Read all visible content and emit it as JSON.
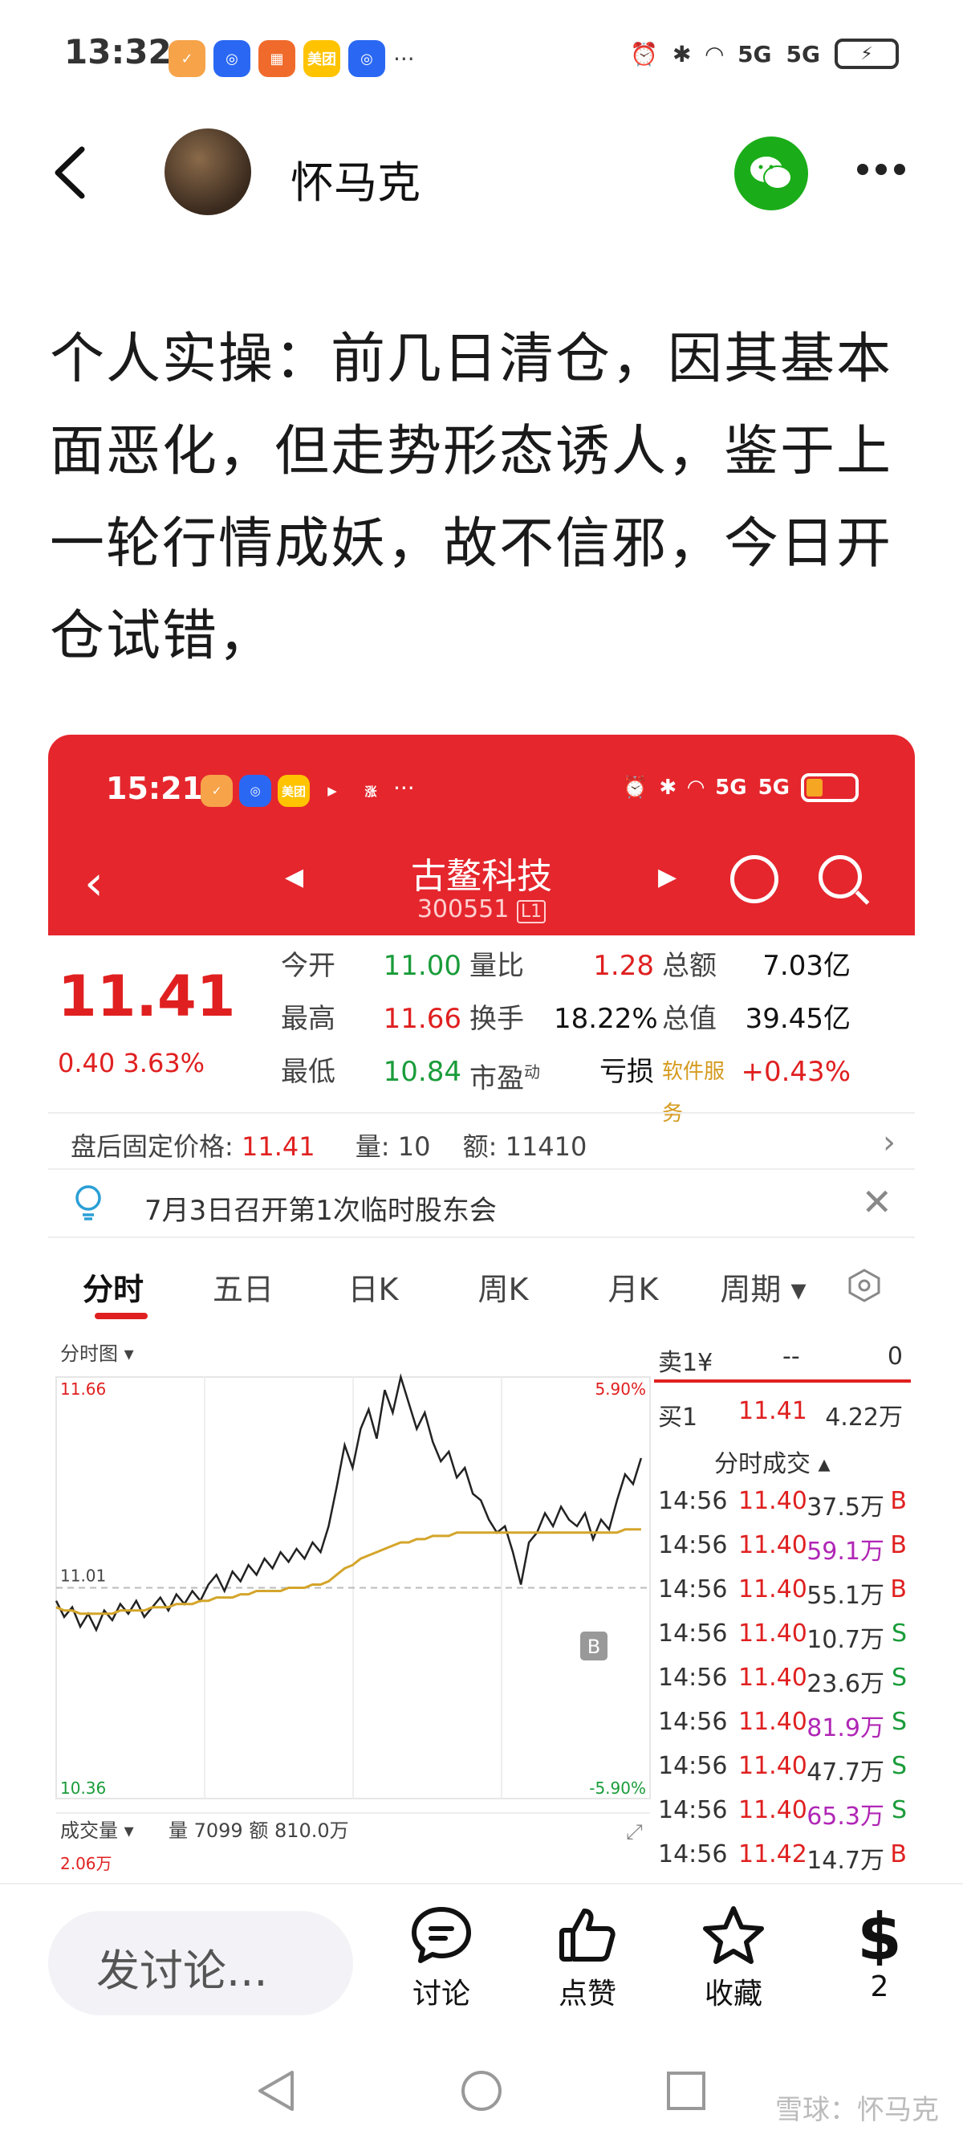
{
  "status_bar": {
    "time": "13:32",
    "apps": [
      {
        "label": "✓",
        "color": "#f6a34a"
      },
      {
        "label": "◎",
        "color": "#2a68f3"
      },
      {
        "label": "▦",
        "color": "#f06b2b"
      },
      {
        "label": "美团",
        "color": "#ffc300"
      },
      {
        "label": "◎",
        "color": "#2a68f3"
      }
    ],
    "more": "···",
    "sim1": "5G",
    "sim2": "5G"
  },
  "header": {
    "username": "怀马克"
  },
  "post": {
    "text": "个人实操：前几日清仓，因其基本面恶化，但走势形态诱人，鉴于上一轮行情成妖，故不信邪，今日开仓试错，"
  },
  "screenshot": {
    "status_time": "15:21",
    "inner_apps": [
      {
        "label": "✓",
        "color": "#f6a34a"
      },
      {
        "label": "◎",
        "color": "#2a68f3"
      },
      {
        "label": "美团",
        "color": "#ffc300"
      },
      {
        "label": "▶",
        "color": "#e5262d"
      },
      {
        "label": "涨",
        "color": "#e5262d"
      }
    ],
    "inner_more": "···",
    "stock_name": "古鳌科技",
    "stock_code": "300551",
    "stock_code_tag": "L1",
    "price": "11.41",
    "change": "0.40",
    "change_pct": "3.63%",
    "quote": {
      "open_label": "今开",
      "open": "11.00",
      "vol_ratio_label": "量比",
      "vol_ratio": "1.28",
      "amount_label": "总额",
      "amount": "7.03亿",
      "high_label": "最高",
      "high": "11.66",
      "turnover_label": "换手",
      "turnover": "18.22%",
      "mcap_label": "总值",
      "mcap": "39.45亿",
      "low_label": "最低",
      "low": "10.84",
      "pe_label": "市盈",
      "pe_sup": "动",
      "pe": "亏损",
      "sector": "软件服务",
      "sector_pct": "+0.43%"
    },
    "after_hours": {
      "label": "盘后固定价格:",
      "price": "11.41",
      "vol_label": "量:",
      "vol": "10",
      "amt_label": "额:",
      "amt": "11410"
    },
    "notice": "7月3日召开第1次临时股东会",
    "tabs": [
      "分时",
      "五日",
      "日K",
      "周K",
      "月K",
      "周期"
    ],
    "chart_title": "分时图",
    "vol_title": "成交量",
    "vol_text": "量 7099",
    "amt_text": "额 810.0万",
    "vol_max": "2.06万",
    "marker": "B",
    "orderbook": {
      "sell1_label": "卖1¥",
      "sell1_price": "--",
      "sell1_vol": "0",
      "buy1_label": "买1",
      "buy1_price": "11.41",
      "buy1_vol": "4.22万",
      "ticks_title": "分时成交",
      "ticks": [
        {
          "t": "14:56",
          "p": "11.40",
          "v": "37.5万",
          "s": "B",
          "hi": false
        },
        {
          "t": "14:56",
          "p": "11.40",
          "v": "59.1万",
          "s": "B",
          "hi": true
        },
        {
          "t": "14:56",
          "p": "11.40",
          "v": "55.1万",
          "s": "B",
          "hi": false
        },
        {
          "t": "14:56",
          "p": "11.40",
          "v": "10.7万",
          "s": "S",
          "hi": false
        },
        {
          "t": "14:56",
          "p": "11.40",
          "v": "23.6万",
          "s": "S",
          "hi": false
        },
        {
          "t": "14:56",
          "p": "11.40",
          "v": "81.9万",
          "s": "S",
          "hi": true
        },
        {
          "t": "14:56",
          "p": "11.40",
          "v": "47.7万",
          "s": "S",
          "hi": false
        },
        {
          "t": "14:56",
          "p": "11.40",
          "v": "65.3万",
          "s": "S",
          "hi": true
        },
        {
          "t": "14:56",
          "p": "11.42",
          "v": "14.7万",
          "s": "B",
          "hi": false
        }
      ]
    }
  },
  "chart_data": {
    "type": "line",
    "title": "分时图",
    "y_max_label": "11.66",
    "y_min_label": "10.36",
    "pct_max_label": "5.90%",
    "pct_min_label": "-5.90%",
    "prev_close_label": "11.01",
    "ylim": [
      10.36,
      11.66
    ],
    "prev_close": 11.01,
    "series": [
      {
        "values": [
          10.97,
          10.92,
          10.95,
          10.89,
          10.93,
          10.88,
          10.94,
          10.91,
          10.96,
          10.93,
          10.97,
          10.92,
          10.95,
          10.98,
          10.94,
          10.99,
          10.96,
          11.0,
          10.97,
          11.02,
          11.05,
          11.0,
          11.06,
          11.03,
          11.08,
          11.05,
          11.1,
          11.07,
          11.12,
          11.09,
          11.13,
          11.1,
          11.15,
          11.12,
          11.2,
          11.32,
          11.45,
          11.38,
          11.5,
          11.56,
          11.47,
          11.62,
          11.55,
          11.66,
          11.58,
          11.5,
          11.55,
          11.46,
          11.4,
          11.43,
          11.35,
          11.38,
          11.3,
          11.28,
          11.22,
          11.18,
          11.2,
          11.12,
          11.02,
          11.15,
          11.18,
          11.24,
          11.2,
          11.26,
          11.22,
          11.2,
          11.24,
          11.16,
          11.22,
          11.19,
          11.28,
          11.36,
          11.33,
          11.41
        ]
      },
      {
        "values": [
          10.95,
          10.94,
          10.94,
          10.93,
          10.93,
          10.93,
          10.93,
          10.93,
          10.94,
          10.94,
          10.94,
          10.94,
          10.95,
          10.95,
          10.95,
          10.96,
          10.96,
          10.96,
          10.97,
          10.97,
          10.98,
          10.98,
          10.98,
          10.99,
          10.99,
          11.0,
          11.0,
          11.0,
          11.0,
          11.01,
          11.01,
          11.01,
          11.02,
          11.02,
          11.03,
          11.05,
          11.07,
          11.08,
          11.1,
          11.11,
          11.12,
          11.13,
          11.14,
          11.15,
          11.15,
          11.16,
          11.16,
          11.17,
          11.17,
          11.17,
          11.18,
          11.18,
          11.18,
          11.18,
          11.18,
          11.18,
          11.18,
          11.18,
          11.18,
          11.18,
          11.18,
          11.18,
          11.18,
          11.18,
          11.18,
          11.18,
          11.18,
          11.18,
          11.18,
          11.18,
          11.18,
          11.19,
          11.19,
          11.19
        ]
      }
    ],
    "grid": true
  },
  "bottom": {
    "input_placeholder": "发讨论...",
    "discuss": "讨论",
    "like": "点赞",
    "collect": "收藏",
    "reward_count": "2"
  },
  "watermark": "雪球：怀马克",
  "colors": {
    "brand_red": "#e5262d",
    "up_red": "#e02020",
    "down_green": "#1a9c3a",
    "wechat_green": "#1aad19",
    "price_line": "#222222",
    "avg_line": "#d4a52a"
  }
}
